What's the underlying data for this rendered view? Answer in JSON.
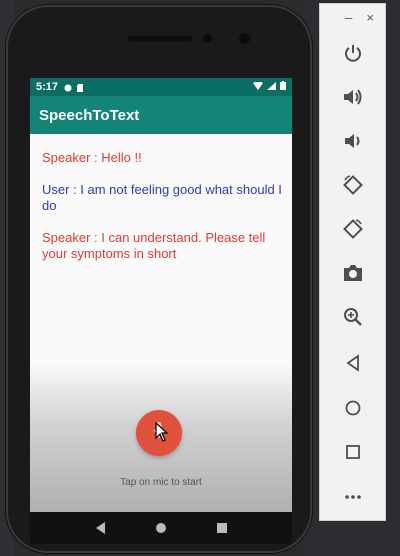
{
  "status_bar": {
    "time": "5:17"
  },
  "app_bar": {
    "title": "SpeechToText"
  },
  "messages": [
    {
      "role": "speaker",
      "text": "Speaker : Hello !!"
    },
    {
      "role": "user",
      "text": "User : I am not feeling good what should I do"
    },
    {
      "role": "speaker",
      "text": "Speaker : I can understand. Please tell your symptoms in short"
    }
  ],
  "mic": {
    "hint": "Tap on mic to start"
  },
  "panel": {
    "tools": [
      "power-icon",
      "volume-up-icon",
      "volume-down-icon",
      "rotate-left-icon",
      "rotate-right-icon",
      "camera-icon",
      "zoom-icon",
      "back-icon",
      "home-icon",
      "overview-icon",
      "more-icon"
    ],
    "minimize": "–",
    "close": "×"
  },
  "colors": {
    "accent": "#128577",
    "status": "#0b6e64",
    "speaker": "#e53935",
    "user": "#2e3bb5",
    "mic": "#e0523e"
  }
}
